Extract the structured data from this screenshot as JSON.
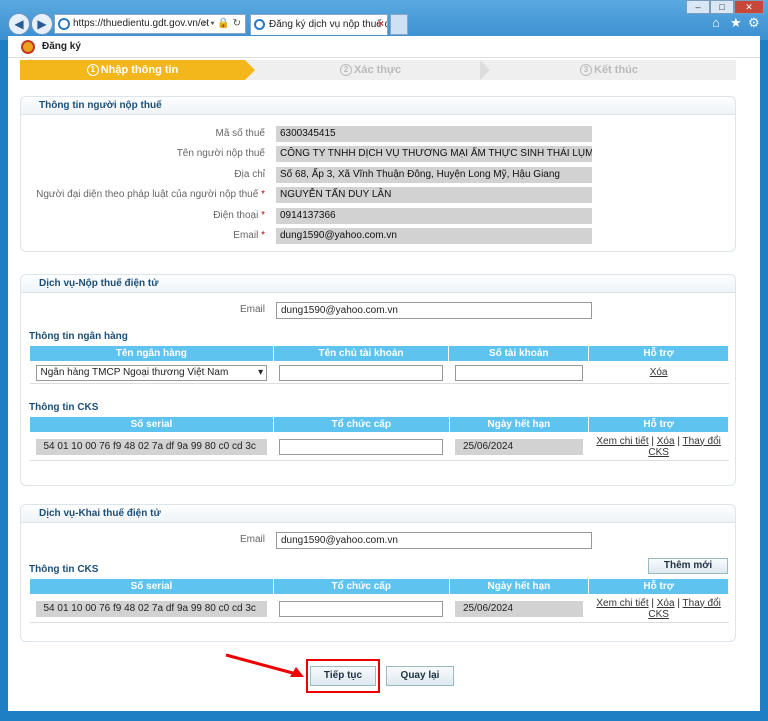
{
  "browser": {
    "address": "https://thuedientu.gdt.gov.vn/et",
    "tab_title": "Đăng ký dịch vụ nộp thuế đ...",
    "minimize": "–",
    "maximize": "□",
    "close": "✕",
    "home_icon": "⌂",
    "star_icon": "★",
    "gear_icon": "⚙"
  },
  "page": {
    "title": "Đăng ký"
  },
  "steps": [
    {
      "num": "1",
      "label": "Nhập thông tin"
    },
    {
      "num": "2",
      "label": "Xác thực"
    },
    {
      "num": "3",
      "label": "Kết thúc"
    }
  ],
  "taxpayer": {
    "section_title": "Thông tin người nộp thuế",
    "fields": [
      {
        "label": "Mã số thuế",
        "required": "",
        "value": "6300345415"
      },
      {
        "label": "Tên người nộp thuế",
        "required": "",
        "value": "CÔNG TY TNHH DỊCH VỤ THƯƠNG MẠI ẨM THỰC SINH THÁI LỤM BIST"
      },
      {
        "label": "Địa chỉ",
        "required": "",
        "value": "Số 68, Ấp 3, Xã Vĩnh Thuận Đông, Huyện Long Mỹ, Hậu Giang"
      },
      {
        "label": "Người đại diện theo pháp luật của người nộp thuế",
        "required": "*",
        "value": "NGUYỄN TẤN DUY LÂN"
      },
      {
        "label": "Điện thoại",
        "required": "*",
        "value": "0914137366"
      },
      {
        "label": "Email",
        "required": "*",
        "value": "dung1590@yahoo.com.vn"
      }
    ]
  },
  "payment": {
    "section_title": "Dịch vụ-Nộp thuế điện tử",
    "email_label": "Email",
    "email_value": "dung1590@yahoo.com.vn",
    "bank_title": "Thông tin ngân hàng",
    "bank_headers": [
      "Tên ngân hàng",
      "Tên chủ tài khoản",
      "Số tài khoản",
      "Hỗ trợ"
    ],
    "bank_row": {
      "bank": "Ngân hàng TMCP Ngoại thương Việt Nam",
      "holder": "",
      "account": "",
      "action": "Xóa"
    },
    "cks_title": "Thông tin CKS",
    "cks_headers": [
      "Số serial",
      "Tổ chức cấp",
      "Ngày hết hạn",
      "Hỗ trợ"
    ],
    "cks_row": {
      "serial": "54 01 10 00 76 f9 48 02 7a df 9a 99 80 c0 cd 3c",
      "issuer": "",
      "expiry": "25/06/2024",
      "view": "Xem chi tiết",
      "delete": "Xóa",
      "change": "Thay đổi CKS"
    }
  },
  "declaration": {
    "section_title": "Dịch vụ-Khai thuế điện tử",
    "email_label": "Email",
    "email_value": "dung1590@yahoo.com.vn",
    "cks_title": "Thông tin CKS",
    "add_button": "Thêm mới",
    "cks_headers": [
      "Số serial",
      "Tổ chức cấp",
      "Ngày hết hạn",
      "Hỗ trợ"
    ],
    "cks_row": {
      "serial": "54 01 10 00 76 f9 48 02 7a df 9a 99 80 c0 cd 3c",
      "issuer": "",
      "expiry": "25/06/2024",
      "view": "Xem chi tiết",
      "delete": "Xóa",
      "change": "Thay đổi CKS"
    }
  },
  "actions": {
    "continue": "Tiếp tục",
    "back": "Quay lại"
  }
}
